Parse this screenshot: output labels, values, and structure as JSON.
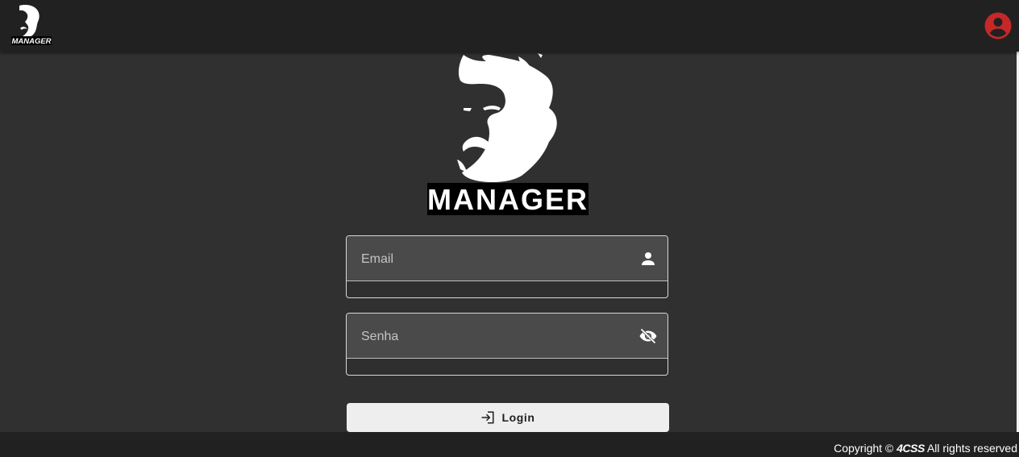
{
  "header": {
    "logo_text": "MANAGER",
    "account_icon": "account-circle-icon",
    "account_color": "#c62828"
  },
  "hero": {
    "logo_text": "MANAGER"
  },
  "form": {
    "email": {
      "placeholder": "Email",
      "value": "",
      "icon": "person-icon"
    },
    "password": {
      "placeholder": "Senha",
      "value": "",
      "icon": "eye-off-icon"
    },
    "login_button": {
      "label": "Login",
      "icon": "login-icon"
    }
  },
  "footer": {
    "copyright_prefix": "Copyright © ",
    "brand": "4CSS",
    "copyright_suffix": " All rights reserved"
  },
  "colors": {
    "topbar": "#212121",
    "background": "#303030",
    "input_fill": "#4a4a4a",
    "button": "#eeeeee",
    "accent_red": "#c62828"
  }
}
